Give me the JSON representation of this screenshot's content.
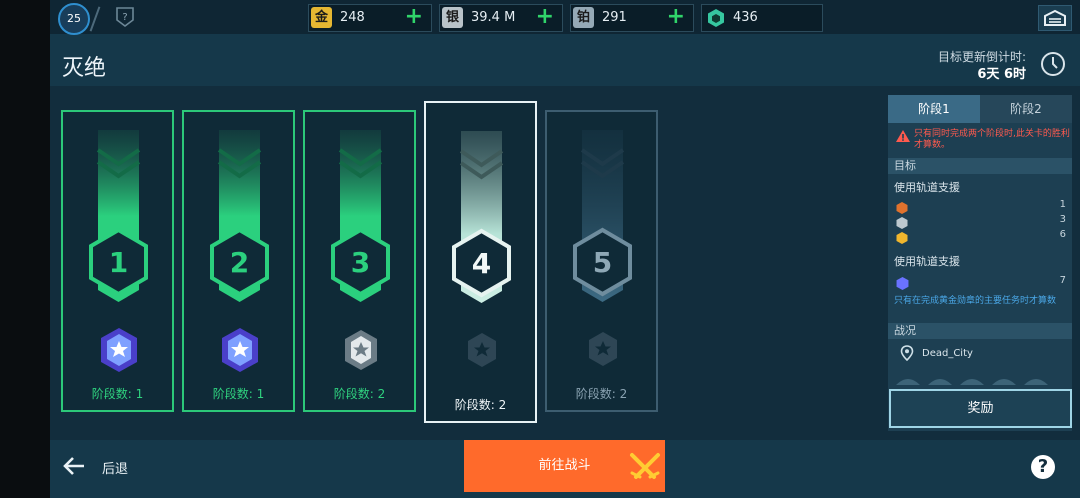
{
  "topbar": {
    "level": "25",
    "resources": [
      {
        "name": "gold",
        "icon_text": "金",
        "icon_color": "#e6b732",
        "value": "248",
        "plus": "+"
      },
      {
        "name": "silver",
        "icon_text": "银",
        "icon_color": "#b9c3c9",
        "value": "39.4 M",
        "plus": "+"
      },
      {
        "name": "platinum",
        "icon_text": "铂",
        "icon_color": "#95a9b6",
        "value": "291",
        "plus": "+"
      },
      {
        "name": "gem",
        "icon_text": "",
        "icon_color": "#36c7a0",
        "value": "436"
      }
    ]
  },
  "header": {
    "title": "灭绝",
    "countdown_label": "目标更新倒计时:",
    "countdown_value": "6天 6时"
  },
  "stages": [
    {
      "number": "1",
      "label": "阶段数: 1",
      "state": "complete",
      "medal": "purple"
    },
    {
      "number": "2",
      "label": "阶段数: 1",
      "state": "complete",
      "medal": "purple"
    },
    {
      "number": "3",
      "label": "阶段数: 2",
      "state": "complete",
      "medal": "silver"
    },
    {
      "number": "4",
      "label": "阶段数: 2",
      "state": "selected",
      "medal": "locked"
    },
    {
      "number": "5",
      "label": "阶段数: 2",
      "state": "locked",
      "medal": "locked"
    }
  ],
  "panel": {
    "tabs": [
      "阶段1",
      "阶段2"
    ],
    "warning": "只有同时完成两个阶段时,此关卡的胜利才算数。",
    "objectives_header": "目标",
    "objective1_text": "使用轨道支援",
    "objective1_rows": [
      {
        "badge": "bronze",
        "count": "1"
      },
      {
        "badge": "silver",
        "count": "3"
      },
      {
        "badge": "gold",
        "count": "6"
      }
    ],
    "objective2_text": "使用轨道支援",
    "objective2_rows": [
      {
        "badge": "purple",
        "count": "7"
      }
    ],
    "note": "只有在完成黄金勋章的主要任务时才算数",
    "battle_header": "战况",
    "map_name": "Dead_City"
  },
  "buttons": {
    "reward": "奖励",
    "back": "后退",
    "go_battle": "前往战斗",
    "help": "?"
  },
  "colors": {
    "accent_green": "#2cc879",
    "orange": "#ff6a2b",
    "warning_red": "#ff5a4e",
    "note_blue": "#4aa7e6"
  }
}
